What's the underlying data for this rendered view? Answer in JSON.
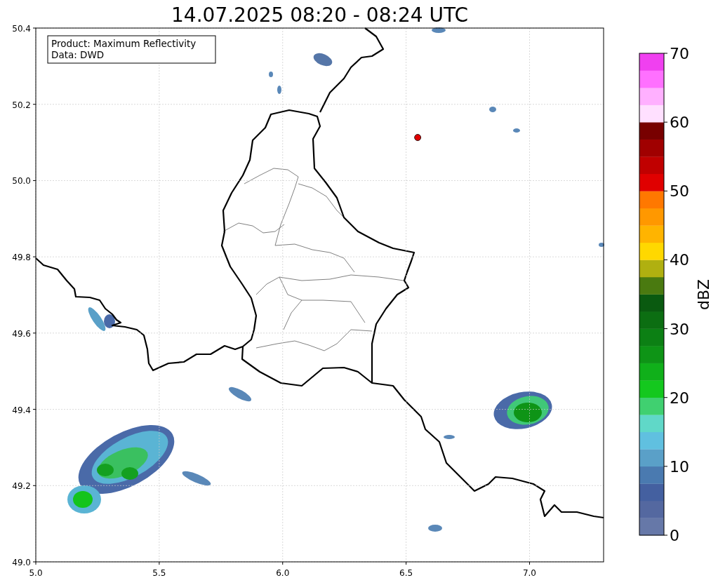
{
  "chart_data": {
    "type": "scatter",
    "title": "14.07.2025 08:20 - 08:24 UTC",
    "x": [
      6.547
    ],
    "series": [
      {
        "color": "#e00000",
        "values": [
          50.113
        ]
      }
    ],
    "grid": true,
    "xlim": [
      5,
      7.3
    ],
    "ylim": [
      49,
      50.4
    ],
    "xticks": [
      {
        "value": 5,
        "label": "5.0"
      },
      {
        "value": 5.5,
        "label": "5.5"
      },
      {
        "value": 6,
        "label": "6.0"
      },
      {
        "value": 6.5,
        "label": "6.5"
      },
      {
        "value": 7,
        "label": "7.0"
      }
    ],
    "yticks": [
      {
        "value": 49,
        "label": "49.0"
      },
      {
        "value": 49.2,
        "label": "49.2"
      },
      {
        "value": 49.4,
        "label": "49.4"
      },
      {
        "value": 49.6,
        "label": "49.6"
      },
      {
        "value": 49.8,
        "label": "49.8"
      },
      {
        "value": 50,
        "label": "50.0"
      },
      {
        "value": 50.2,
        "label": "50.2"
      },
      {
        "value": 50.4,
        "label": "50.4"
      }
    ],
    "annotations": [
      "Product: Maximum Reflectivity",
      "Data: DWD"
    ]
  },
  "colorbar": {
    "label": "dBZ",
    "ticks": [
      "70",
      "60",
      "50",
      "40",
      "30",
      "20",
      "10",
      "0"
    ],
    "segments": [
      {
        "color": "#6678a8"
      },
      {
        "color": "#5468a0"
      },
      {
        "color": "#4460a0"
      },
      {
        "color": "#4a7ab0"
      },
      {
        "color": "#5aa0c8"
      },
      {
        "color": "#60c0e0"
      },
      {
        "color": "#60d8c8"
      },
      {
        "color": "#40d070"
      },
      {
        "color": "#14c81e"
      },
      {
        "color": "#10b01a"
      },
      {
        "color": "#0e9416"
      },
      {
        "color": "#0c8014"
      },
      {
        "color": "#0c6e12"
      },
      {
        "color": "#0a5a10"
      },
      {
        "color": "#4a7a10"
      },
      {
        "color": "#b0b010"
      },
      {
        "color": "#ffd800"
      },
      {
        "color": "#ffb400"
      },
      {
        "color": "#ff9800"
      },
      {
        "color": "#ff7800"
      },
      {
        "color": "#e00000"
      },
      {
        "color": "#c00000"
      },
      {
        "color": "#a00000"
      },
      {
        "color": "#780000"
      },
      {
        "color": "#ffe0ff"
      },
      {
        "color": "#ffb0ff"
      },
      {
        "color": "#ff70ff"
      },
      {
        "color": "#f040f0"
      }
    ]
  }
}
